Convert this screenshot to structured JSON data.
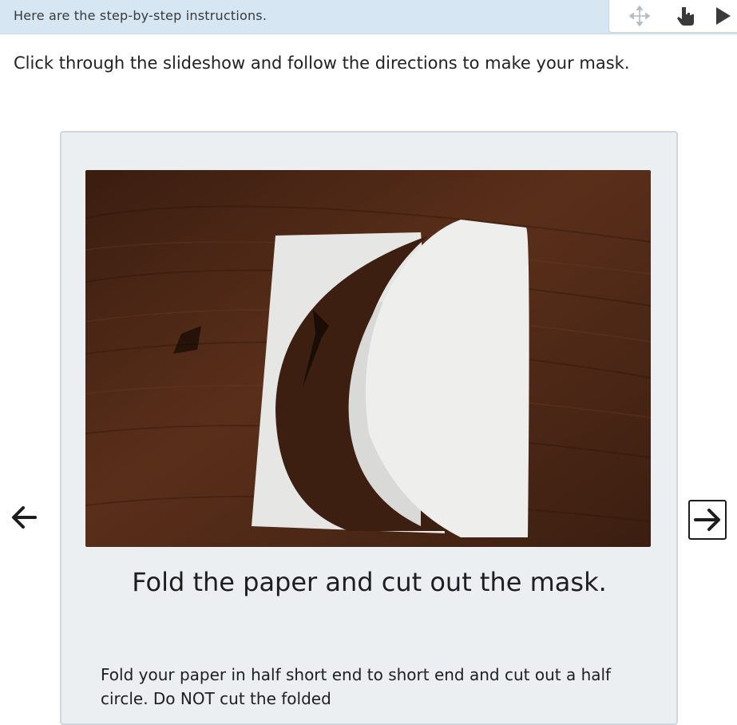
{
  "header": {
    "title": "Here are the step-by-step instructions.",
    "tools": [
      {
        "name": "move-icon"
      },
      {
        "name": "hand-pointer-icon"
      },
      {
        "name": "play-icon"
      }
    ]
  },
  "intro": {
    "text": "Click through the slideshow and follow the directions to make your mask."
  },
  "slideshow": {
    "slide": {
      "image_alt": "White paper folded in half with a half circle cut out, on a dark wooden table",
      "title": "Fold the paper and cut out the mask.",
      "body": "Fold your paper in half short end to short end and cut out a half circle. Do NOT cut the folded"
    },
    "prev_icon": "arrow-left-icon",
    "next_icon": "arrow-right-icon"
  },
  "colors": {
    "header_bg": "#d6e6f2",
    "card_bg": "#eceff1",
    "wood": "#4a2616",
    "paper": "#eeeeec"
  }
}
